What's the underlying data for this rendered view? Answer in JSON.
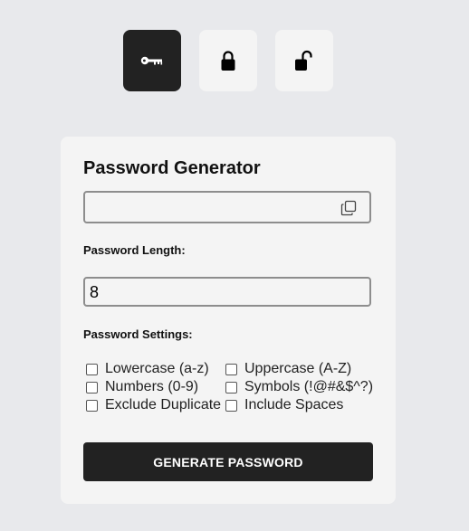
{
  "modes": [
    {
      "name": "key",
      "icon": "key-icon",
      "active": true
    },
    {
      "name": "lock",
      "icon": "lock-icon",
      "active": false
    },
    {
      "name": "unlock",
      "icon": "unlock-icon",
      "active": false
    }
  ],
  "card": {
    "title": "Password Generator",
    "output": {
      "value": "",
      "copy_icon": "copy-icon"
    },
    "length_label": "Password Length:",
    "length_value": "8",
    "settings_label": "Password Settings:",
    "options": [
      {
        "label": "Lowercase (a-z)",
        "checked": false
      },
      {
        "label": "Uppercase (A-Z)",
        "checked": false
      },
      {
        "label": "Numbers (0-9)",
        "checked": false
      },
      {
        "label": "Symbols (!@#&$^?)",
        "checked": false
      },
      {
        "label": "Exclude Duplicate",
        "checked": false
      },
      {
        "label": "Include Spaces",
        "checked": false
      }
    ],
    "generate_label": "GENERATE PASSWORD"
  },
  "colors": {
    "background": "#e8e9ec",
    "card": "#f4f4f4",
    "dark": "#222222"
  }
}
